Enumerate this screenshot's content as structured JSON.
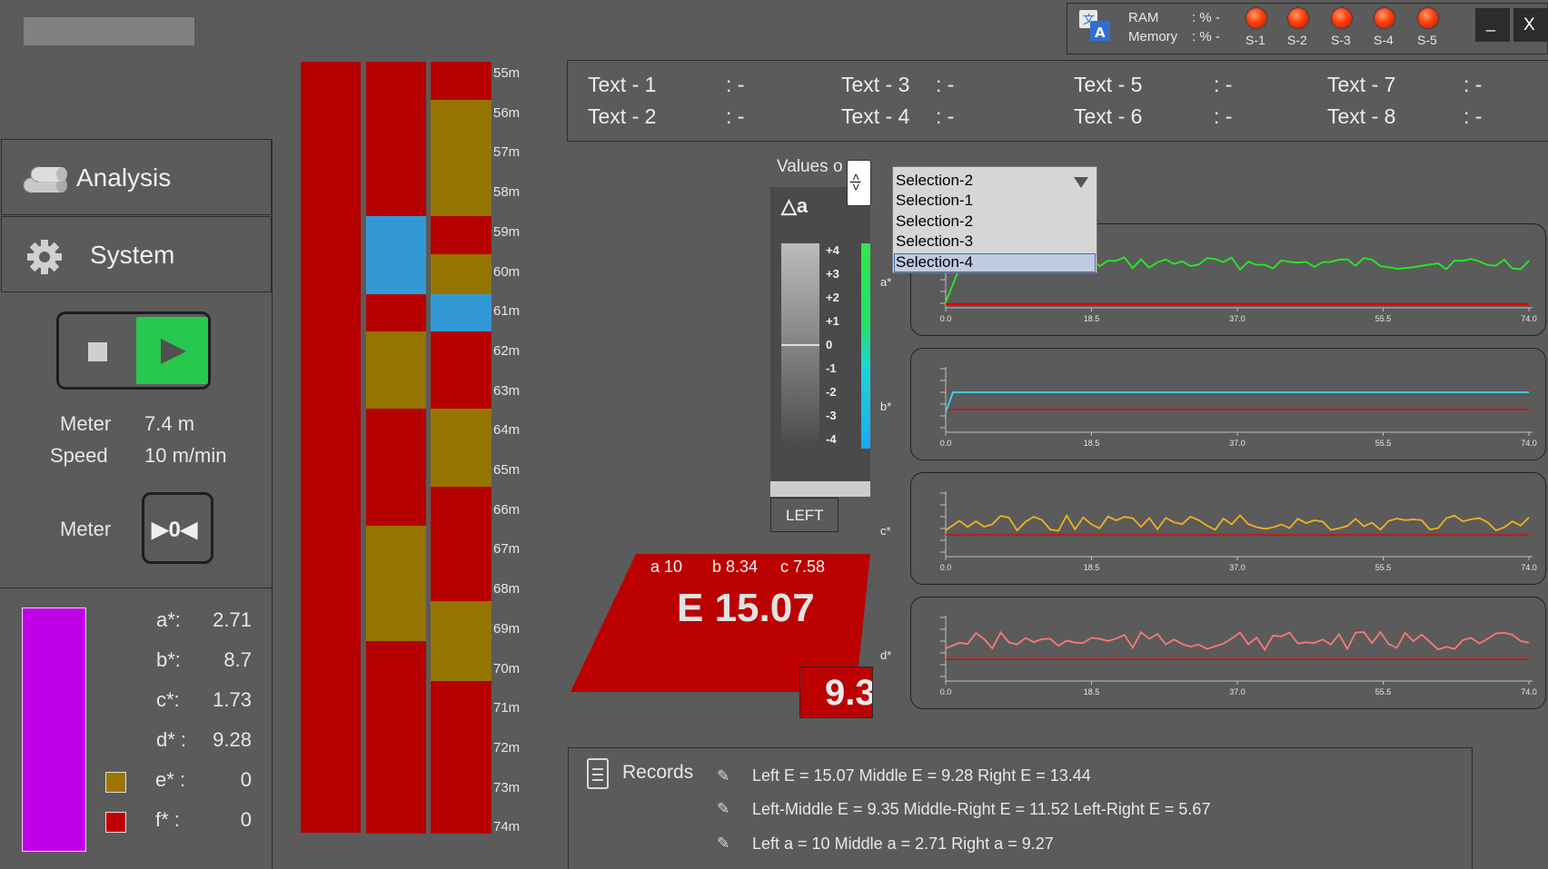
{
  "sidebar": {
    "title_bar_placeholder": "",
    "nav": [
      {
        "label": "Analysis",
        "icon": "pipes-icon"
      },
      {
        "label": "System",
        "icon": "gear-icon"
      }
    ],
    "meter_label": "Meter",
    "meter_value": "7.4 m",
    "speed_label": "Speed",
    "speed_value": "10 m/min",
    "meter_reset_label": "Meter",
    "meter_reset_button": "▶0◀",
    "swatch_color": "#c000e8",
    "values": [
      {
        "label": "a*:",
        "value": "2.71"
      },
      {
        "label": "b*:",
        "value": "8.7"
      },
      {
        "label": "c*:",
        "value": "1.73"
      },
      {
        "label": "d* :",
        "value": "9.28"
      },
      {
        "label": "e* :",
        "value": "0",
        "color": "#9a7600"
      },
      {
        "label": "f* :",
        "value": "0",
        "color": "#c00000"
      }
    ]
  },
  "ruler": {
    "labels": [
      "55m",
      "56m",
      "57m",
      "58m",
      "59m",
      "60m",
      "61m",
      "62m",
      "63m",
      "64m",
      "65m",
      "66m",
      "67m",
      "68m",
      "69m",
      "70m",
      "71m",
      "72m",
      "73m",
      "74m"
    ],
    "colors": {
      "red": "#b60000",
      "olive": "#957400",
      "blue": "#3399d6"
    }
  },
  "status": {
    "ram_label": "RAM",
    "ram_value": ": % -",
    "memory_label": "Memory",
    "memory_value": ": % -",
    "lamps": [
      "S-1",
      "S-2",
      "S-3",
      "S-4",
      "S-5"
    ],
    "minimize_label": "_",
    "close_label": "X"
  },
  "text_table": [
    {
      "label": "Text - 1",
      "value": ": -"
    },
    {
      "label": "Text - 2",
      "value": ": -"
    },
    {
      "label": "Text - 3",
      "value": ": -"
    },
    {
      "label": "Text - 4",
      "value": ": -"
    },
    {
      "label": "Text - 5",
      "value": ": -"
    },
    {
      "label": "Text - 6",
      "value": ": -"
    },
    {
      "label": "Text - 7",
      "value": ": -"
    },
    {
      "label": "Text - 8",
      "value": ": -"
    }
  ],
  "gauge": {
    "values_label": "Values o",
    "toggle_label": "<|>",
    "delta_label": "△a",
    "scale": [
      "+4",
      "+3",
      "+2",
      "+1",
      "0",
      "-1",
      "-2",
      "-3",
      "-4"
    ],
    "left_button": "LEFT"
  },
  "dropdown": {
    "selected": "Selection-2",
    "options": [
      "Selection-1",
      "Selection-2",
      "Selection-3",
      "Selection-4"
    ],
    "highlighted": "Selection-4"
  },
  "result": {
    "a": "a 10",
    "b": "b 8.34",
    "c": "c 7.58",
    "e": "E 15.07",
    "secondary": "9.3"
  },
  "charts": {
    "x_ticks": [
      "0.0",
      "18.5",
      "37.0",
      "55.5",
      "74.0"
    ],
    "labels": [
      "a*",
      "b*",
      "c*",
      "d*"
    ],
    "colors": [
      "#22ee22",
      "#33ddee",
      "#f0b020",
      "#ff7777"
    ],
    "threshold_color": "#e00000"
  },
  "records": {
    "title": "Records",
    "lines": [
      "Left E = 15.07 Middle E = 9.28 Right E = 13.44",
      "Left-Middle E = 9.35 Middle-Right E = 11.52 Left-Right E = 5.67",
      "Left a = 10 Middle a = 2.71 Right a = 9.27"
    ]
  }
}
